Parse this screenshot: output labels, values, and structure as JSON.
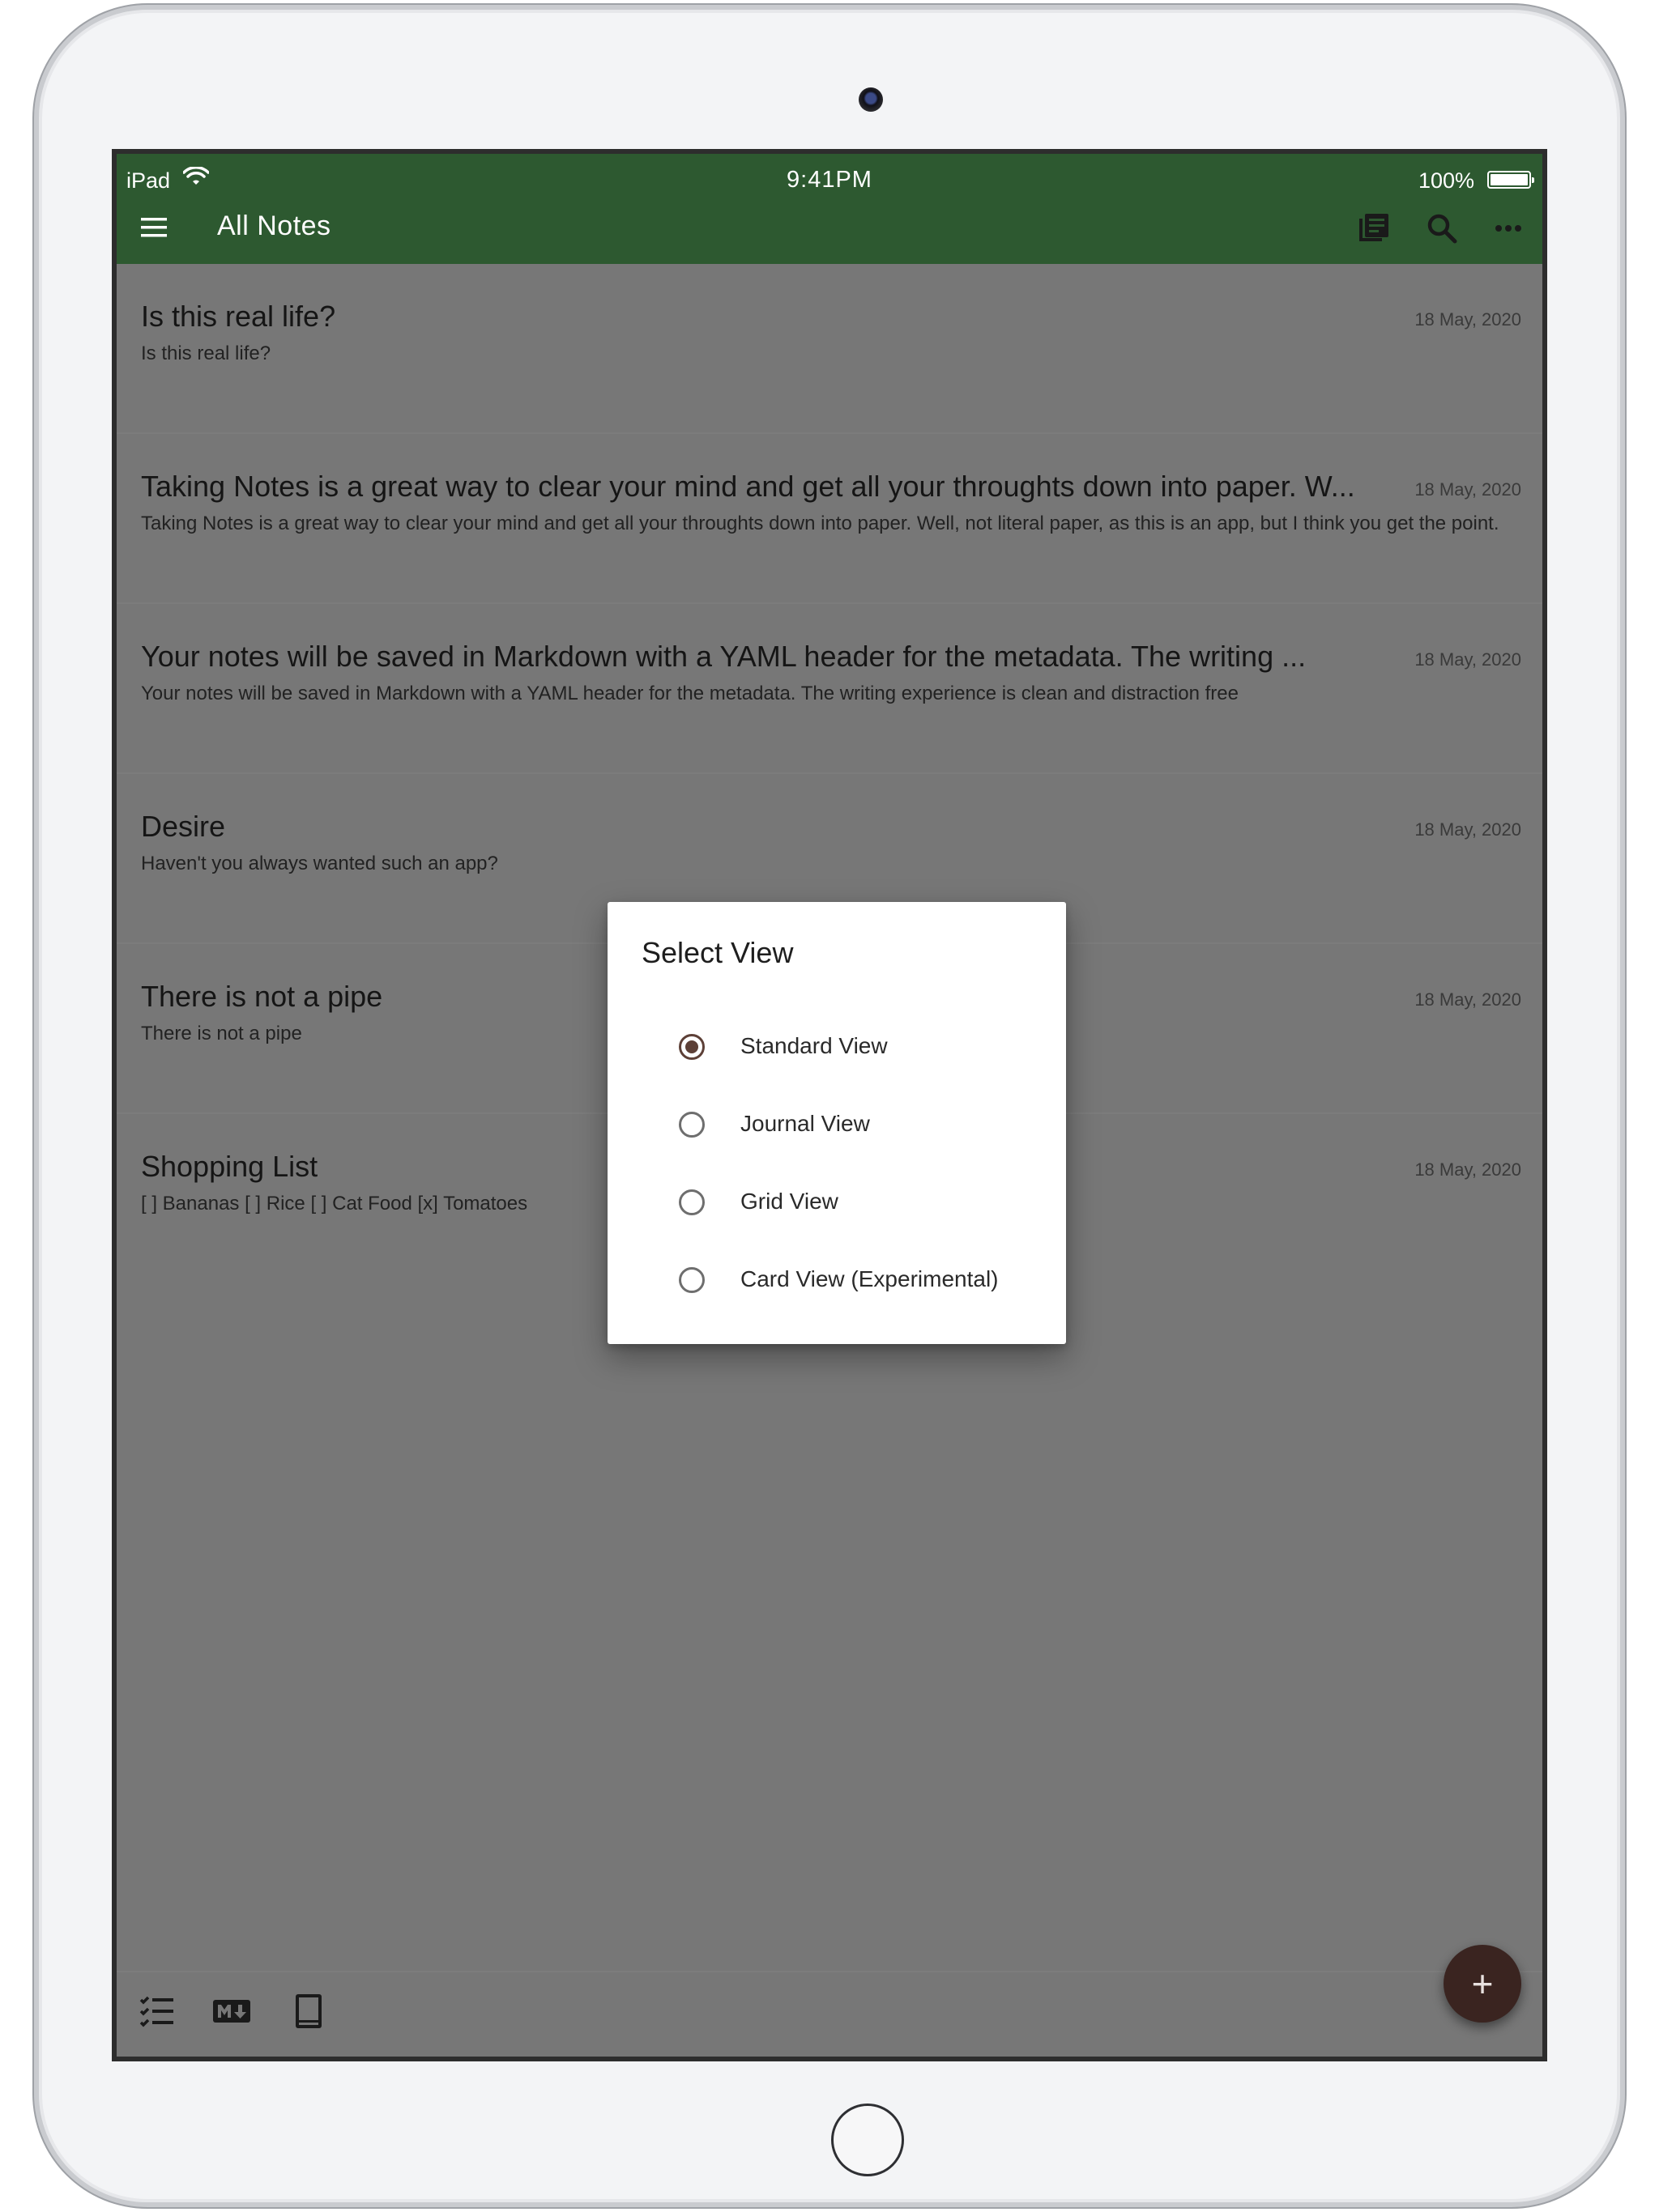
{
  "status_bar": {
    "carrier": "iPad",
    "time": "9:41PM",
    "battery": "100%"
  },
  "app_bar": {
    "title": "All Notes"
  },
  "notes": [
    {
      "title": "Is this real life?",
      "date": "18 May, 2020",
      "preview": "Is this real life?"
    },
    {
      "title": "Taking Notes is a great way to clear your mind and get all your throughts down into paper. W...",
      "date": "18 May, 2020",
      "preview": "Taking Notes is a great way to clear your mind and get all your throughts down into paper. Well, not literal paper, as this is an app, but I think you get the point."
    },
    {
      "title": "Your notes will be saved in Markdown with a YAML header for the metadata. The writing ...",
      "date": "18 May, 2020",
      "preview": "Your notes will be saved in Markdown with a YAML header for the metadata. The writing experience is clean and distraction free"
    },
    {
      "title": "Desire",
      "date": "18 May, 2020",
      "preview": "Haven't you always wanted such an app?"
    },
    {
      "title": "There is not a pipe",
      "date": "18 May, 2020",
      "preview": "There is not a pipe"
    },
    {
      "title": "Shopping List",
      "date": "18 May, 2020",
      "preview": "[ ] Bananas [ ] Rice [ ] Cat Food [x] Tomatoes"
    }
  ],
  "dialog": {
    "title": "Select View",
    "options": [
      {
        "label": "Standard View",
        "selected": true
      },
      {
        "label": "Journal View",
        "selected": false
      },
      {
        "label": "Grid View",
        "selected": false
      },
      {
        "label": "Card View (Experimental)",
        "selected": false
      }
    ]
  },
  "bottom_bar": {
    "icons": [
      "checklist-icon",
      "markdown-icon",
      "notebook-icon"
    ]
  },
  "fab": {
    "label": "+"
  },
  "colors": {
    "app_bar": "#2d5930",
    "accent": "#5d4037",
    "fab": "#3a2420",
    "scrim": "#777777"
  }
}
